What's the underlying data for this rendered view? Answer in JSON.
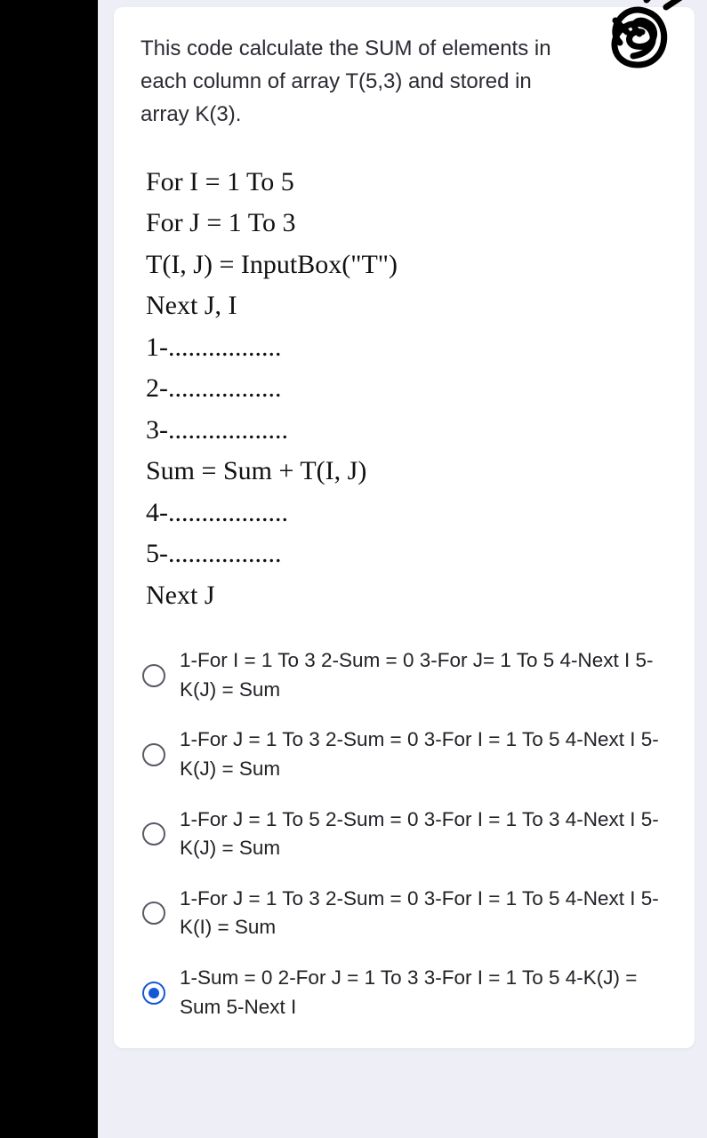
{
  "question": {
    "intro": "This code calculate the SUM of elements  in each column of array T(5,3) and stored in array K(3).",
    "code_lines": [
      "For I = 1 To 5",
      "For J = 1 To 3",
      "T(I, J) = InputBox(\"T\")",
      "Next J, I",
      "1-.................",
      "2-.................",
      "3-..................",
      "Sum = Sum + T(I, J)",
      "4-..................",
      "5-.................",
      "Next J"
    ]
  },
  "options": [
    {
      "text": "1-For I = 1 To 3 2-Sum = 0 3-For J= 1 To 5 4-Next I 5-K(J) = Sum",
      "selected": false
    },
    {
      "text": "1-For J = 1 To 3 2-Sum = 0 3-For I = 1 To 5 4-Next I 5-K(J) = Sum",
      "selected": false
    },
    {
      "text": "1-For J = 1 To 5 2-Sum = 0 3-For I = 1 To 3 4-Next I 5-K(J) = Sum",
      "selected": false
    },
    {
      "text": "1-For J = 1 To 3 2-Sum = 0 3-For I = 1 To 5 4-Next I 5-K(I) = Sum",
      "selected": false
    },
    {
      "text": "1-Sum = 0 2-For J = 1 To 3 3-For I = 1 To 5 4-K(J) = Sum 5-Next I",
      "selected": true
    }
  ]
}
